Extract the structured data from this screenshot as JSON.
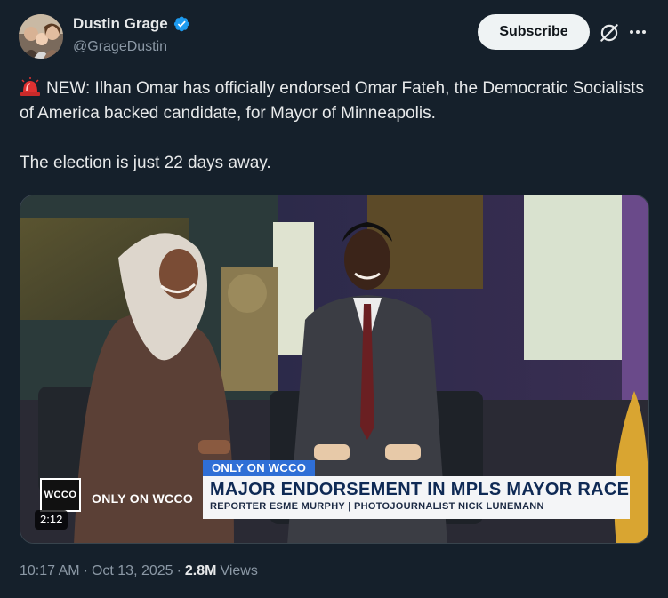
{
  "author": {
    "display_name": "Dustin Grage",
    "handle": "@GrageDustin",
    "verified": true,
    "verified_color": "#1d9bf0"
  },
  "actions": {
    "subscribe_label": "Subscribe",
    "grok_icon": "grok-icon",
    "more_icon": "more-icon"
  },
  "tweet": {
    "line1": "NEW: Ilhan Omar has officially endorsed Omar Fateh, the Democratic Socialists of America backed candidate, for Mayor of Minneapolis.",
    "line2": "The election is just 22 days away.",
    "emoji": "siren-icon"
  },
  "video": {
    "chyron_tag": "ONLY ON WCCO",
    "chyron_headline": "MAJOR ENDORSEMENT IN MPLS MAYOR RACE",
    "chyron_sub": "REPORTER ESME MURPHY | PHOTOJOURNALIST NICK LUNEMANN",
    "logo_text": "WCCO",
    "logo_label": "ONLY ON WCCO",
    "duration": "2:12"
  },
  "meta": {
    "time": "10:17 AM",
    "date": "Oct 13, 2025",
    "views_count": "2.8M",
    "views_label": "Views"
  }
}
